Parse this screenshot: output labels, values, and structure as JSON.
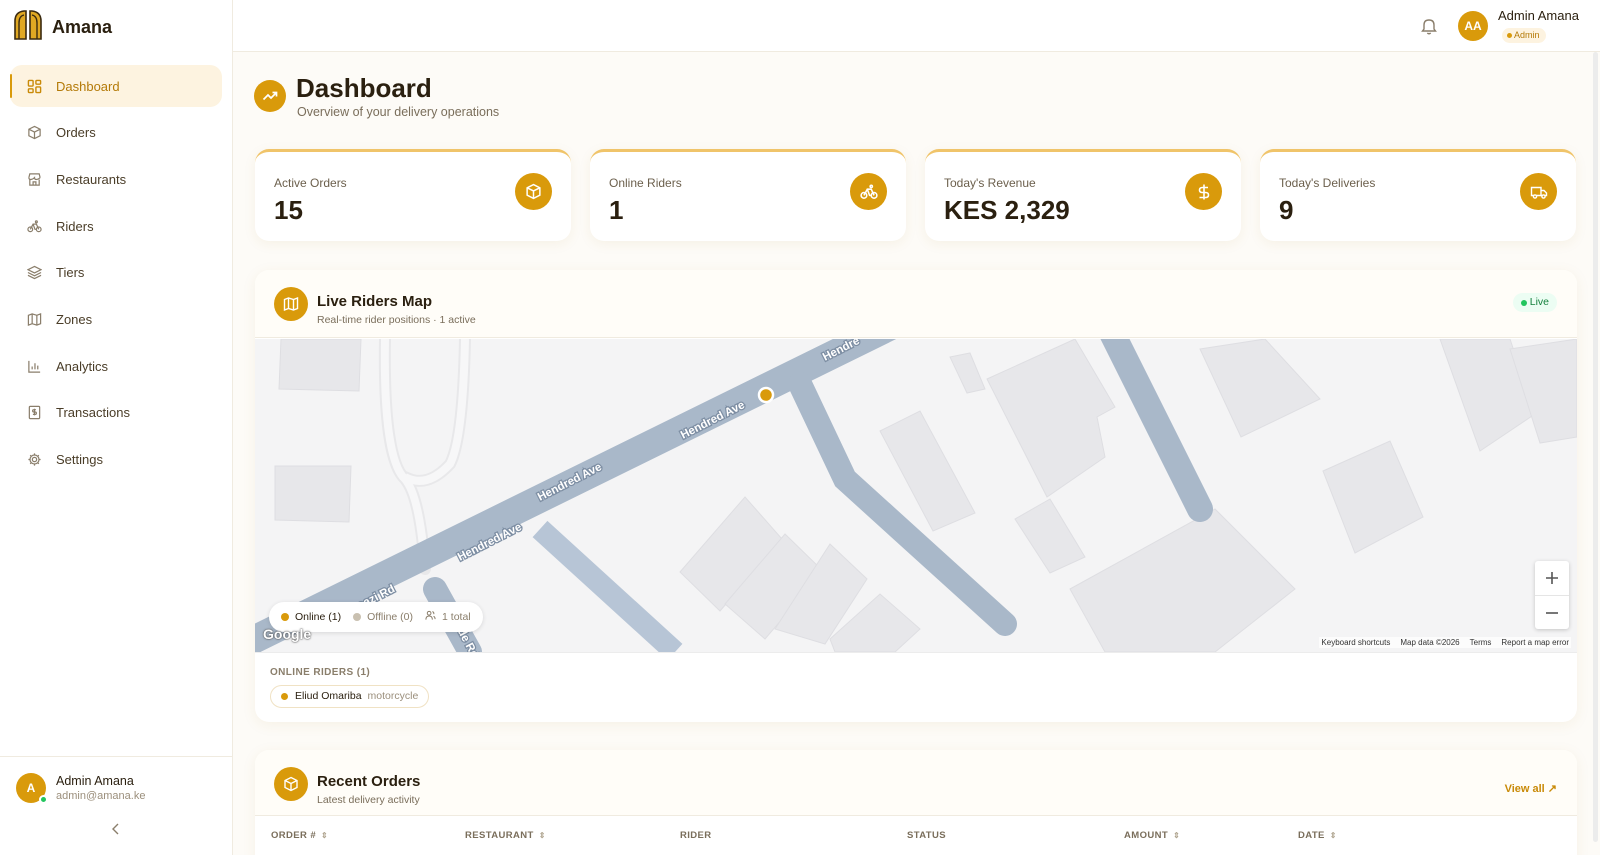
{
  "brand": {
    "name": "Amana"
  },
  "sidebar": {
    "items": [
      {
        "label": "Dashboard",
        "icon": "dashboard-icon",
        "active": true
      },
      {
        "label": "Orders",
        "icon": "package-icon"
      },
      {
        "label": "Restaurants",
        "icon": "store-icon"
      },
      {
        "label": "Riders",
        "icon": "bike-icon"
      },
      {
        "label": "Tiers",
        "icon": "layers-icon"
      },
      {
        "label": "Zones",
        "icon": "map-icon"
      },
      {
        "label": "Analytics",
        "icon": "bar-chart-icon"
      },
      {
        "label": "Transactions",
        "icon": "receipt-icon"
      },
      {
        "label": "Settings",
        "icon": "gear-icon"
      }
    ],
    "user": {
      "initial": "A",
      "name": "Admin Amana",
      "email": "admin@amana.ke"
    }
  },
  "topbar": {
    "initials": "AA",
    "name": "Admin Amana",
    "role": "Admin"
  },
  "header": {
    "title": "Dashboard",
    "subtitle": "Overview of your delivery operations"
  },
  "stats": [
    {
      "label": "Active Orders",
      "value": "15",
      "icon": "package-icon"
    },
    {
      "label": "Online Riders",
      "value": "1",
      "icon": "bike-icon"
    },
    {
      "label": "Today's Revenue",
      "value": "KES 2,329",
      "icon": "dollar-icon"
    },
    {
      "label": "Today's Deliveries",
      "value": "9",
      "icon": "truck-icon"
    }
  ],
  "map": {
    "title": "Live Riders Map",
    "subtitle": "Real-time rider positions · 1 active",
    "live_label": "Live",
    "streets": [
      "Hendred Ave",
      "Hendred Ave",
      "Hendred Ave",
      "Hendred Ave",
      "Mbaazi Rd",
      "Kunde Rd",
      "Hendre"
    ],
    "legend": {
      "online": "Online (1)",
      "offline": "Offline (0)",
      "total": "1 total"
    },
    "google": "Google",
    "attribution": [
      "Keyboard shortcuts",
      "Map data ©2026",
      "Terms",
      "Report a map error"
    ],
    "riders_label": "ONLINE RIDERS (1)",
    "riders": [
      {
        "name": "Eliud Omariba",
        "vehicle": "motorcycle"
      }
    ]
  },
  "orders": {
    "title": "Recent Orders",
    "subtitle": "Latest delivery activity",
    "view_all": "View all ↗",
    "columns": [
      "ORDER #",
      "RESTAURANT",
      "RIDER",
      "STATUS",
      "AMOUNT",
      "DATE"
    ]
  },
  "colors": {
    "accent": "#d99a0b",
    "live": "#22c55e"
  }
}
